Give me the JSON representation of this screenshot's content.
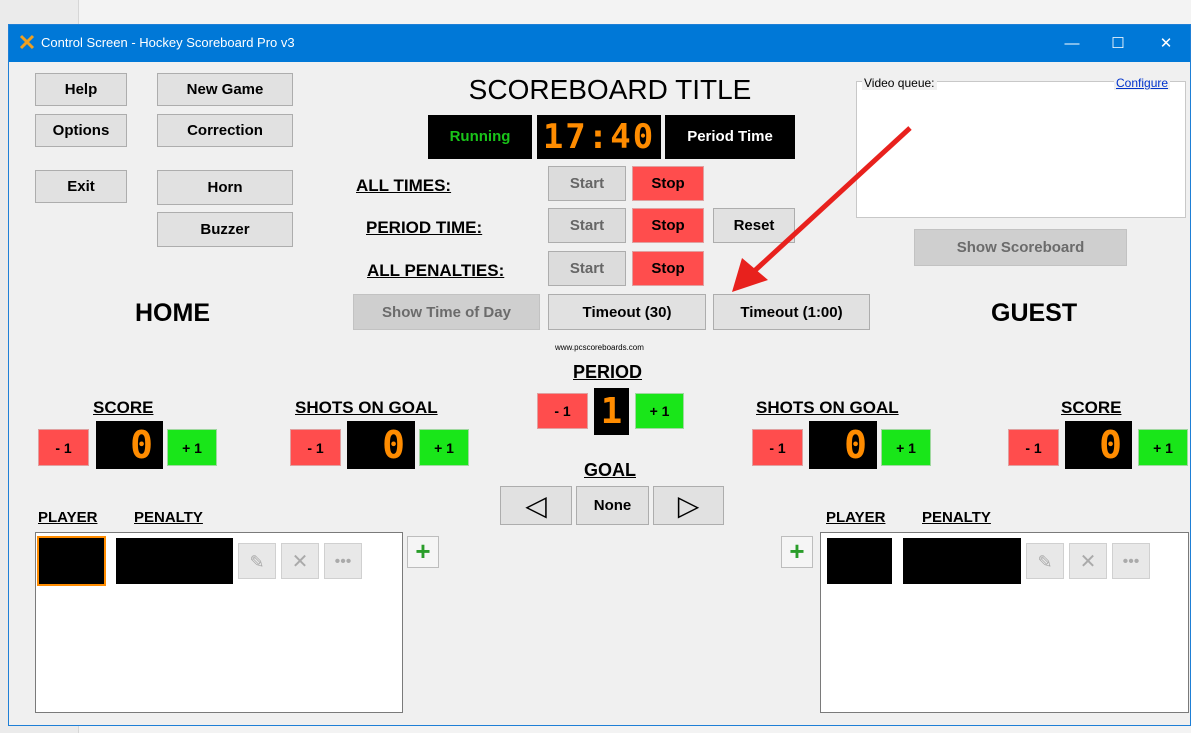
{
  "window": {
    "title": "Control Screen - Hockey Scoreboard Pro v3",
    "minimize": "—",
    "maximize": "☐",
    "close": "✕"
  },
  "left_buttons": {
    "help": "Help",
    "new_game": "New Game",
    "options": "Options",
    "correction": "Correction",
    "exit": "Exit",
    "horn": "Horn",
    "buzzer": "Buzzer"
  },
  "scoreboard_title": "SCOREBOARD TITLE",
  "clock": {
    "status": "Running",
    "time": "17:40",
    "mode": "Period Time"
  },
  "controls": {
    "all_times": "ALL TIMES:",
    "period_time": "PERIOD TIME:",
    "all_penalties": "ALL PENALTIES:",
    "start": "Start",
    "stop": "Stop",
    "reset": "Reset"
  },
  "middle_buttons": {
    "show_time_of_day": "Show Time of Day",
    "timeout_30": "Timeout (30)",
    "timeout_100": "Timeout (1:00)"
  },
  "video": {
    "label": "Video queue:",
    "configure": "Configure",
    "show_scoreboard": "Show Scoreboard"
  },
  "website": "www.pcscoreboards.com",
  "home": {
    "title": "HOME",
    "score_label": "SCORE",
    "score": "0",
    "shots_label": "SHOTS ON GOAL",
    "shots": "0"
  },
  "guest": {
    "title": "GUEST",
    "score_label": "SCORE",
    "score": "0",
    "shots_label": "SHOTS ON GOAL",
    "shots": "0"
  },
  "period": {
    "label": "PERIOD",
    "value": "1"
  },
  "goal": {
    "label": "GOAL",
    "value": "None",
    "left_arrow": "◁",
    "right_arrow": "▷"
  },
  "common": {
    "minus": "- 1",
    "plus": "+ 1"
  },
  "penalty": {
    "player_header": "PLAYER",
    "penalty_header": "PENALTY"
  },
  "colors": {
    "titlebar": "#0078d7",
    "running": "#19c419",
    "digit": "#ff8c00",
    "red": "#ff4d4d",
    "green": "#19e619",
    "annotation_arrow": "#e8211d"
  }
}
